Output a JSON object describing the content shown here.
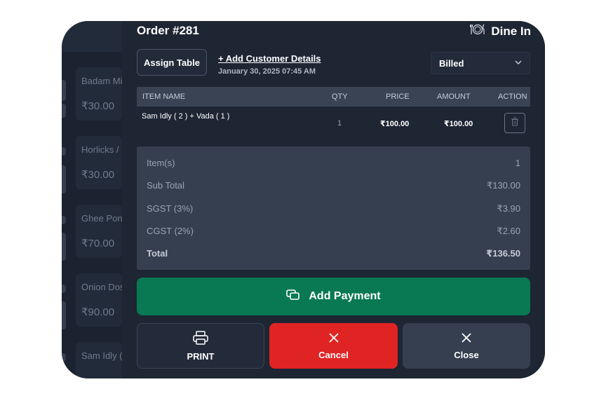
{
  "menu": {
    "items": [
      {
        "name": "Badam Milk",
        "price": "₹30.00"
      },
      {
        "name": "Horlicks / B",
        "price": "₹30.00"
      },
      {
        "name": "Ghee Pong",
        "price": "₹70.00"
      },
      {
        "name": "Onion Dos",
        "price": "₹90.00"
      },
      {
        "name": "Sam Idly (",
        "price": ""
      }
    ]
  },
  "order": {
    "title": "Order #281",
    "type_label": "Dine In",
    "assign_table_label": "Assign Table",
    "add_customer_label": "+ Add Customer Details",
    "date": "January 30, 2025 07:45 AM",
    "status": "Billed"
  },
  "table": {
    "headers": {
      "item": "ITEM NAME",
      "qty": "QTY",
      "price": "PRICE",
      "amount": "AMOUNT",
      "action": "ACTION"
    },
    "rows": [
      {
        "item": "Sam Idly ( 2 ) + Vada ( 1 )",
        "qty": "1",
        "price": "₹100.00",
        "amount": "₹100.00"
      }
    ]
  },
  "summary": {
    "items_label": "Item(s)",
    "items_value": "1",
    "subtotal_label": "Sub Total",
    "subtotal_value": "₹130.00",
    "sgst_label": "SGST (3%)",
    "sgst_value": "₹3.90",
    "cgst_label": "CGST (2%)",
    "cgst_value": "₹2.60",
    "total_label": "Total",
    "total_value": "₹136.50"
  },
  "actions": {
    "add_payment": "Add Payment",
    "print": "PRINT",
    "cancel": "Cancel",
    "close": "Close"
  },
  "colors": {
    "panel_bg": "#1e2533",
    "accent_green": "#087952",
    "danger_red": "#e02424",
    "summary_bg": "#353f50"
  },
  "icons": {
    "dine_in": "plate-cutlery-icon",
    "delete": "trash-icon",
    "payment": "cards-icon",
    "print": "printer-icon",
    "cancel": "x-icon",
    "close": "x-icon",
    "dropdown": "chevron-down-icon"
  }
}
